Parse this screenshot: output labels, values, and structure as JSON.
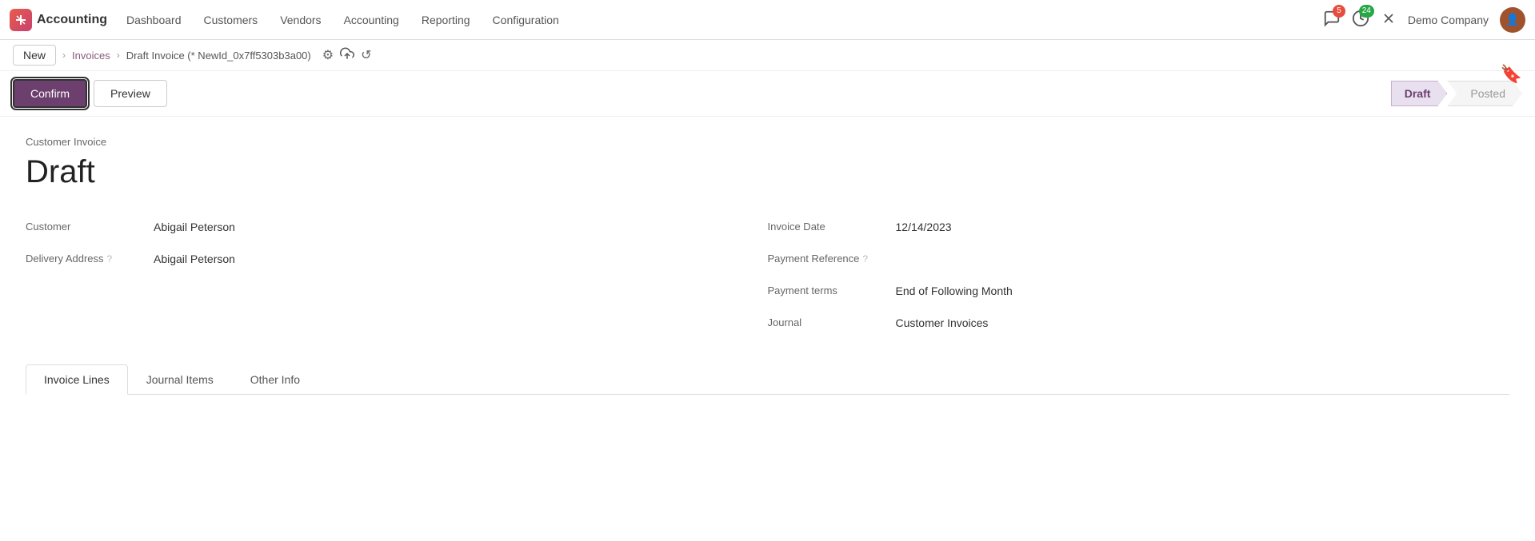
{
  "app": {
    "logo_text": "✕",
    "brand": "Accounting"
  },
  "topnav": {
    "items": [
      {
        "id": "dashboard",
        "label": "Dashboard"
      },
      {
        "id": "customers",
        "label": "Customers"
      },
      {
        "id": "vendors",
        "label": "Vendors"
      },
      {
        "id": "accounting",
        "label": "Accounting"
      },
      {
        "id": "reporting",
        "label": "Reporting"
      },
      {
        "id": "configuration",
        "label": "Configuration"
      }
    ],
    "notifications_badge": "5",
    "clock_badge": "24",
    "company": "Demo Company"
  },
  "breadcrumb": {
    "new_label": "New",
    "parent_link": "Invoices",
    "current": "Draft Invoice (* NewId_0x7ff5303b3a00)"
  },
  "actions": {
    "confirm_label": "Confirm",
    "preview_label": "Preview"
  },
  "status": {
    "draft_label": "Draft",
    "posted_label": "Posted"
  },
  "invoice": {
    "type_label": "Customer Invoice",
    "title": "Draft",
    "customer_label": "Customer",
    "customer_value": "Abigail Peterson",
    "delivery_address_label": "Delivery Address",
    "delivery_address_value": "Abigail Peterson",
    "invoice_date_label": "Invoice Date",
    "invoice_date_value": "12/14/2023",
    "payment_reference_label": "Payment Reference",
    "payment_reference_value": "",
    "payment_terms_label": "Payment terms",
    "payment_terms_value": "End of Following Month",
    "journal_label": "Journal",
    "journal_value": "Customer Invoices"
  },
  "tabs": [
    {
      "id": "invoice-lines",
      "label": "Invoice Lines",
      "active": true
    },
    {
      "id": "journal-items",
      "label": "Journal Items",
      "active": false
    },
    {
      "id": "other-info",
      "label": "Other Info",
      "active": false
    }
  ],
  "icons": {
    "logo": "✦",
    "gear": "⚙",
    "upload": "⬆",
    "undo": "↺",
    "chat": "💬",
    "clock": "🕐",
    "close": "✕",
    "bookmark": "🔖"
  }
}
